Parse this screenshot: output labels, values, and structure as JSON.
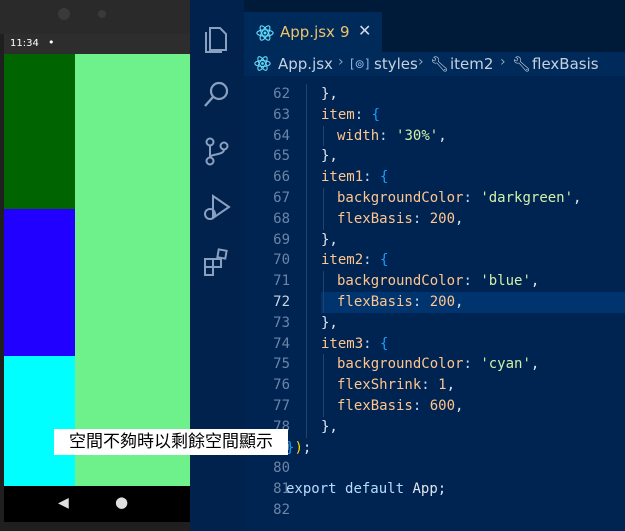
{
  "phone": {
    "status_time": "11:34",
    "status_dot": "•",
    "nav": {
      "back": "◀",
      "home": "●",
      "recent": "■"
    },
    "colors": {
      "background": "#6ef08a",
      "item1": "#006400",
      "item2": "#2200ff",
      "item3": "#00ffff"
    }
  },
  "editor": {
    "activity_icons": [
      "files-icon",
      "search-icon",
      "source-control-icon",
      "run-debug-icon",
      "extensions-icon"
    ],
    "tab": {
      "name": "App.jsx",
      "badge": "9",
      "close": "✕"
    },
    "breadcrumb": [
      "App.jsx",
      "styles",
      "item2",
      "flexBasis"
    ],
    "lines": [
      {
        "n": "62",
        "text": "},",
        "indent": 1
      },
      {
        "n": "63",
        "text": "item: {",
        "indent": 1
      },
      {
        "n": "64",
        "text": "width: '30%',",
        "indent": 2
      },
      {
        "n": "65",
        "text": "},",
        "indent": 1
      },
      {
        "n": "66",
        "text": "item1: {",
        "indent": 1
      },
      {
        "n": "67",
        "text": "backgroundColor: 'darkgreen',",
        "indent": 2
      },
      {
        "n": "68",
        "text": "flexBasis: 200,",
        "indent": 2
      },
      {
        "n": "69",
        "text": "},",
        "indent": 1
      },
      {
        "n": "70",
        "text": "item2: {",
        "indent": 1
      },
      {
        "n": "71",
        "text": "backgroundColor: 'blue',",
        "indent": 2
      },
      {
        "n": "72",
        "text": "flexBasis: 200,",
        "indent": 2,
        "active": true
      },
      {
        "n": "73",
        "text": "},",
        "indent": 1
      },
      {
        "n": "74",
        "text": "item3: {",
        "indent": 1
      },
      {
        "n": "75",
        "text": "backgroundColor: 'cyan',",
        "indent": 2
      },
      {
        "n": "76",
        "text": "flexShrink: 1,",
        "indent": 2
      },
      {
        "n": "77",
        "text": "flexBasis: 600,",
        "indent": 2
      },
      {
        "n": "78",
        "text": "},",
        "indent": 1
      },
      {
        "n": "79",
        "text": "});",
        "indent": 0
      },
      {
        "n": "80",
        "text": "",
        "indent": 0
      },
      {
        "n": "81",
        "text": "export default App;",
        "indent": 0
      },
      {
        "n": "82",
        "text": "",
        "indent": 0
      }
    ]
  },
  "caption": "空間不夠時以剩餘空間顯示"
}
